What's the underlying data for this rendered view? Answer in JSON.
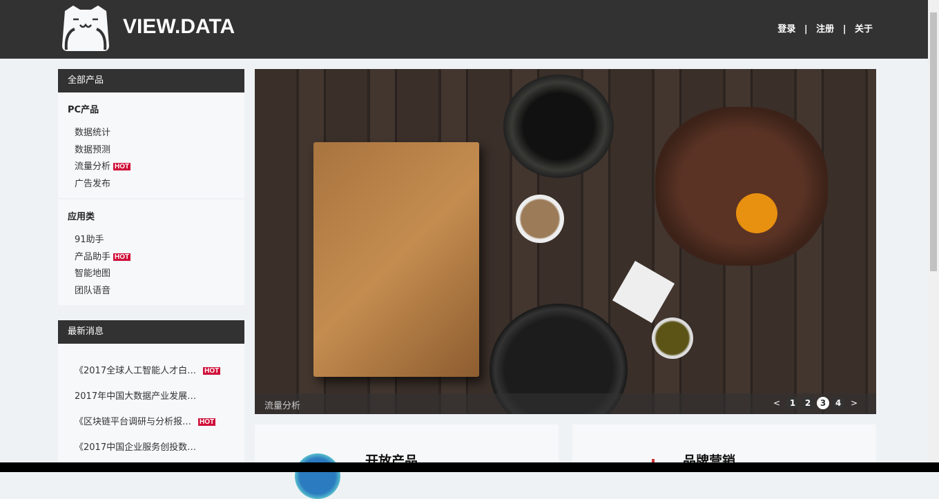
{
  "header": {
    "brand": "VIEW.DATA",
    "nav": [
      "登录",
      "注册",
      "关于"
    ],
    "sep": "|"
  },
  "products": {
    "title": "全部产品",
    "groups": [
      {
        "title": "PC产品",
        "items": [
          {
            "label": "数据统计"
          },
          {
            "label": "数据预测"
          },
          {
            "label": "流量分析",
            "hot": "HOT"
          },
          {
            "label": "广告发布"
          }
        ]
      },
      {
        "title": "应用类",
        "items": [
          {
            "label": "91助手"
          },
          {
            "label": "产品助手",
            "hot": "HOT"
          },
          {
            "label": "智能地图"
          },
          {
            "label": "团队语音"
          }
        ]
      }
    ]
  },
  "news": {
    "title": "最新消息",
    "items": [
      {
        "label": "《2017全球人工智能人才白…",
        "hot": "HOT"
      },
      {
        "label": "2017年中国大数据产业发展…"
      },
      {
        "label": "《区块链平台调研与分析报…",
        "hot": "HOT"
      },
      {
        "label": "《2017中国企业服务创投数…"
      }
    ]
  },
  "banner": {
    "caption": "流量分析",
    "prev": "<",
    "next": ">",
    "pages": [
      "1",
      "2",
      "3",
      "4"
    ],
    "active_page": 3
  },
  "cards": [
    {
      "title": "开放产品"
    },
    {
      "title": "品牌营销"
    }
  ]
}
